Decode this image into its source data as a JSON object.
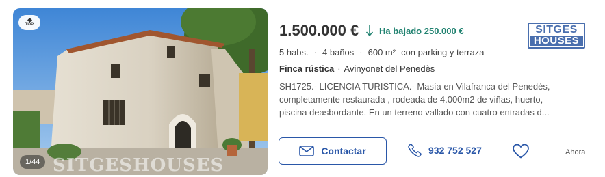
{
  "listing": {
    "badge": "TOP",
    "photo_counter": "1/44",
    "photo_watermark": "SITGESHOUSES",
    "price": "1.500.000 €",
    "price_drop": "Ha bajado 250.000 €",
    "features": [
      "5 habs.",
      "4 baños",
      "600 m²",
      "con parking y terraza"
    ],
    "property_type": "Finca rústica",
    "location": "Avinyonet del Penedès",
    "description_lines": [
      "SH1725.- LICENCIA TURISTICA.- Masía en Vilafranca del Penedés,",
      "completamente restaurada , rodeada de 4.000m2 de viñas, huerto,",
      "piscina deasbordante. En un terreno vallado con cuatro entradas d..."
    ],
    "agency_logo": {
      "line1": "SITGES",
      "line2": "HOUSES"
    },
    "contact_label": "Contactar",
    "phone": "932 752 527",
    "posted": "Ahora"
  },
  "icons": {
    "price_drop": "arrow-down-icon",
    "contact": "envelope-icon",
    "phone": "phone-icon",
    "favorite": "heart-icon",
    "badge": "diamond-icon"
  },
  "colors": {
    "accent": "#2a57a8",
    "price_drop": "#208270",
    "logo": "#4a6fae"
  }
}
